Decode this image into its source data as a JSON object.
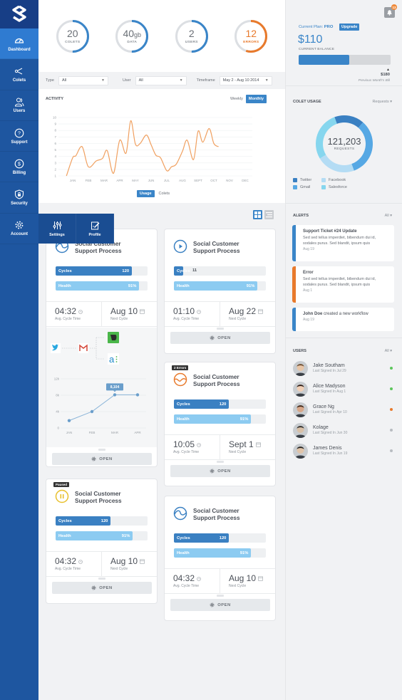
{
  "sidebar": {
    "items": [
      {
        "label": "Dashboard",
        "icon": "gauge-icon",
        "active": true
      },
      {
        "label": "Colets",
        "icon": "share-icon"
      },
      {
        "label": "Users",
        "icon": "users-icon"
      },
      {
        "label": "Support",
        "icon": "help-icon"
      },
      {
        "label": "Billing",
        "icon": "dollar-icon"
      },
      {
        "label": "Security",
        "icon": "shield-lock-icon"
      },
      {
        "label": "Account",
        "icon": "gear-icon"
      }
    ],
    "submenu": [
      {
        "label": "Settings",
        "icon": "sliders-icon"
      },
      {
        "label": "Profile",
        "icon": "edit-profile-icon"
      }
    ]
  },
  "stats": [
    {
      "value": "20",
      "unit": "",
      "label": "COLETS",
      "fraction": 0.5,
      "color": "#3a85c8"
    },
    {
      "value": "40",
      "unit": "gb",
      "label": "DATA",
      "fraction": 0.5,
      "color": "#3a85c8"
    },
    {
      "value": "2",
      "unit": "",
      "label": "USERS",
      "fraction": 0.5,
      "color": "#3a85c8"
    },
    {
      "value": "12",
      "unit": "",
      "label": "ERRORS",
      "fraction": 0.55,
      "color": "#e87a2c"
    }
  ],
  "filters": {
    "type_label": "Type",
    "type_value": "All",
    "user_label": "User",
    "user_value": "All",
    "timeframe_label": "Timeframe",
    "timeframe_value": "May 2 - Aug 10 2014"
  },
  "activity": {
    "title": "ACTIVITY",
    "weekly": "Weekly",
    "monthly": "Monthly",
    "usage": "Usage",
    "colets": "Colets"
  },
  "chart_data": [
    {
      "type": "line",
      "title": "ACTIVITY",
      "xlabel": "",
      "ylabel": "",
      "categories": [
        "JAN",
        "FEB",
        "MAR",
        "APR",
        "MAY",
        "JUN",
        "JUL",
        "AUG",
        "SEPT",
        "OCT",
        "NOV",
        "DEC"
      ],
      "ylim": [
        1,
        10
      ],
      "yticks": [
        1,
        2,
        3,
        4,
        5,
        6,
        7,
        8,
        9,
        10
      ],
      "grid": true,
      "color": "#f0a060",
      "x": [
        -0.4,
        0,
        0.2,
        0.6,
        1,
        1.5,
        1.9,
        2.2,
        2.6,
        3,
        3.4,
        3.7,
        4,
        4.3,
        4.7,
        5,
        5.3,
        5.6,
        6,
        6.3,
        6.6,
        7,
        7.3,
        7.7,
        8,
        8.3,
        8.7,
        9,
        9.3,
        9.7,
        10,
        10.3,
        10.6,
        10.8
      ],
      "series": [
        {
          "name": "Usage",
          "values": [
            1,
            3.8,
            4.1,
            5.5,
            2.4,
            3.3,
            3.7,
            4.9,
            1.4,
            6.5,
            4.5,
            9.5,
            5.9,
            6,
            7.3,
            5.8,
            4.2,
            3.8,
            1.8,
            2.4,
            2.8,
            4.8,
            6.5,
            3.5,
            7.9,
            6.2,
            8.3,
            6,
            5.5,
            1,
            1,
            1,
            1,
            1
          ]
        }
      ]
    },
    {
      "type": "line",
      "title": "",
      "categories": [
        "JAN",
        "FEB",
        "MAR",
        "APR"
      ],
      "yticks": [
        "0",
        "4k",
        "8k",
        "12k"
      ],
      "ylim": [
        0,
        12000
      ],
      "series": [
        {
          "name": "Requests",
          "values": [
            1800,
            4000,
            8104,
            8104
          ]
        }
      ],
      "annotation": "8,104"
    },
    {
      "type": "pie",
      "title": "COLET USAGE",
      "center_value": "121,203",
      "center_label": "REQUESTS",
      "slices": [
        {
          "name": "Twitter",
          "value": 17,
          "color": "#3a80c2"
        },
        {
          "name": "Gmail",
          "value": 33,
          "color": "#56a8e4"
        },
        {
          "name": "Facebook",
          "value": 22,
          "color": "#b4dcf4"
        },
        {
          "name": "Salesforce",
          "value": 28,
          "color": "#86d6ee"
        }
      ]
    }
  ],
  "grid_view": {
    "active": "grid"
  },
  "cards": [
    {
      "title1": "Social Customer",
      "title2": "Support Process",
      "status": "normal",
      "cycles_label": "Cycles",
      "cycles": "120",
      "cycles_frac": 0.83,
      "health_label": "Health",
      "health": "91%",
      "health_frac": 0.91,
      "time": "04:32",
      "time_label": "Avg. Cycle Time",
      "next": "Aug 10",
      "next_label": "Next Cycle",
      "open": "OPEN"
    },
    {
      "title1": "Social Customer",
      "title2": "Support Process",
      "status": "play",
      "cycles_label": "Cycles",
      "cycles": "11",
      "cycles_frac": 0.1,
      "health_label": "Health",
      "health": "91%",
      "health_frac": 0.91,
      "time": "01:10",
      "time_label": "Avg. Cycle Time",
      "next": "Aug 22",
      "next_label": "Next Cycle",
      "open": "OPEN"
    },
    {
      "title1": "Social Customer",
      "title2": "Support Process",
      "status": "error",
      "badge": "2 Errors",
      "cycles_label": "Cycles",
      "cycles": "120",
      "cycles_frac": 0.6,
      "health_label": "Health",
      "health": "91%",
      "health_frac": 0.84,
      "time": "10:05",
      "time_label": "Avg. Cycle Time",
      "next": "Sept 1",
      "next_label": "Next Cycle",
      "open": "OPEN"
    },
    {
      "title1": "Social Customer",
      "title2": "Support Process",
      "status": "paused",
      "badge": "Paused",
      "cycles_label": "Cycles",
      "cycles": "120",
      "cycles_frac": 0.6,
      "health_label": "Health",
      "health": "91%",
      "health_frac": 0.84,
      "time": "04:32",
      "time_label": "Avg. Cycle Time",
      "next": "Aug 10",
      "next_label": "Next Cycle",
      "open": "OPEN"
    },
    {
      "title1": "Social Customer",
      "title2": "Support Process",
      "status": "normal",
      "cycles_label": "Cycles",
      "cycles": "120",
      "cycles_frac": 0.6,
      "health_label": "Health",
      "health": "91%",
      "health_frac": 0.84,
      "time": "04:32",
      "time_label": "Avg. Cycle Time",
      "next": "Aug 10",
      "next_label": "Next Cycle",
      "open": "OPEN"
    }
  ],
  "plan": {
    "label": "Current Plan: ",
    "plan": "PRO",
    "upgrade": "Upgrade",
    "amount": "$110",
    "amount_label": "CURRENT BALANCE",
    "balance_fraction": 0.55,
    "previous": "$180",
    "previous_label": "Previous Month's Bill",
    "notifications": "13"
  },
  "colet_usage": {
    "title": "COLET USAGE",
    "dropdown": "Requests"
  },
  "alerts": {
    "title": "ALERTS",
    "filter": "All",
    "items": [
      {
        "title": "Support Ticket #24 Update",
        "body": "Sed sed tellus imperdiet, bibendum dui id, sodales purus. Sed blandit, ipsum quis",
        "date": "Aug 19",
        "color": "#3a85c8"
      },
      {
        "title": "Error",
        "body": "Sed sed tellus imperdiet, bibendum dui id, sodales purus. Sed blandit, ipsum quis",
        "date": "Aug 1",
        "color": "#e87a2c"
      },
      {
        "title": "John Doe",
        "title_rest": " created a new workflow",
        "body": "",
        "date": "Aug 19",
        "color": "#3a85c8"
      }
    ]
  },
  "users": {
    "title": "USERS",
    "filter": "All",
    "items": [
      {
        "name": "Jake Southam",
        "last": "Last Signed In Jul 29",
        "status": "online",
        "color": "#5cc65c"
      },
      {
        "name": "Alice Madyson",
        "last": "Last Signed In Aug 1",
        "status": "online",
        "color": "#5cc65c"
      },
      {
        "name": "Grace Ng",
        "last": "Last Signed In Apr 10",
        "status": "away",
        "color": "#e87a2c"
      },
      {
        "name": "Kolage",
        "last": "Last Signed In Jun 30",
        "status": "offline",
        "color": "#b8bcc1"
      },
      {
        "name": "James Denis",
        "last": "Last Signed In Jun 19",
        "status": "offline",
        "color": "#b8bcc1"
      }
    ]
  }
}
